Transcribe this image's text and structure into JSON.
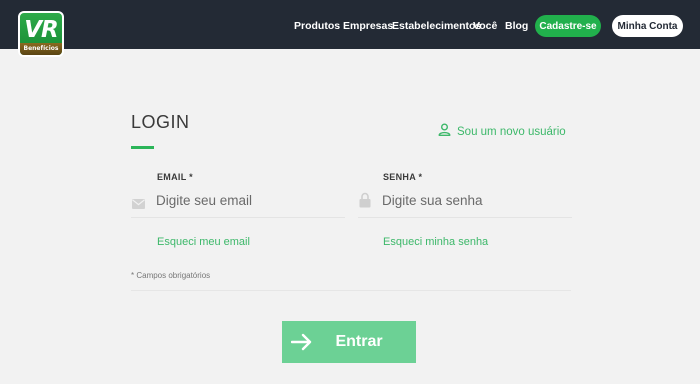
{
  "brand": {
    "logo_text": "VR",
    "logo_subtext": "Benefícios"
  },
  "nav": {
    "items": [
      "Produtos",
      "Empresas",
      "Estabelecimentos",
      "Você",
      "Blog"
    ],
    "cadastro_label": "Cadastre-se",
    "conta_label": "Minha Conta"
  },
  "login": {
    "title": "LOGIN",
    "new_user_label": "Sou um novo usuário",
    "email": {
      "label": "EMAIL *",
      "placeholder": "Digite seu email",
      "forgot_label": "Esqueci meu email"
    },
    "senha": {
      "label": "SENHA *",
      "placeholder": "Digite sua senha",
      "forgot_label": "Esqueci minha senha"
    },
    "required_note": "* Campos obrigatórios",
    "submit_label": "Entrar"
  },
  "colors": {
    "header_bg": "#232a35",
    "accent_green": "#21b04c",
    "link_green": "#3db86a",
    "button_green": "#6cd195",
    "page_bg": "#f2f2f2"
  },
  "icons": {
    "new_user": "user-icon",
    "email": "envelope-icon",
    "senha": "lock-icon",
    "submit": "arrow-right-icon"
  }
}
